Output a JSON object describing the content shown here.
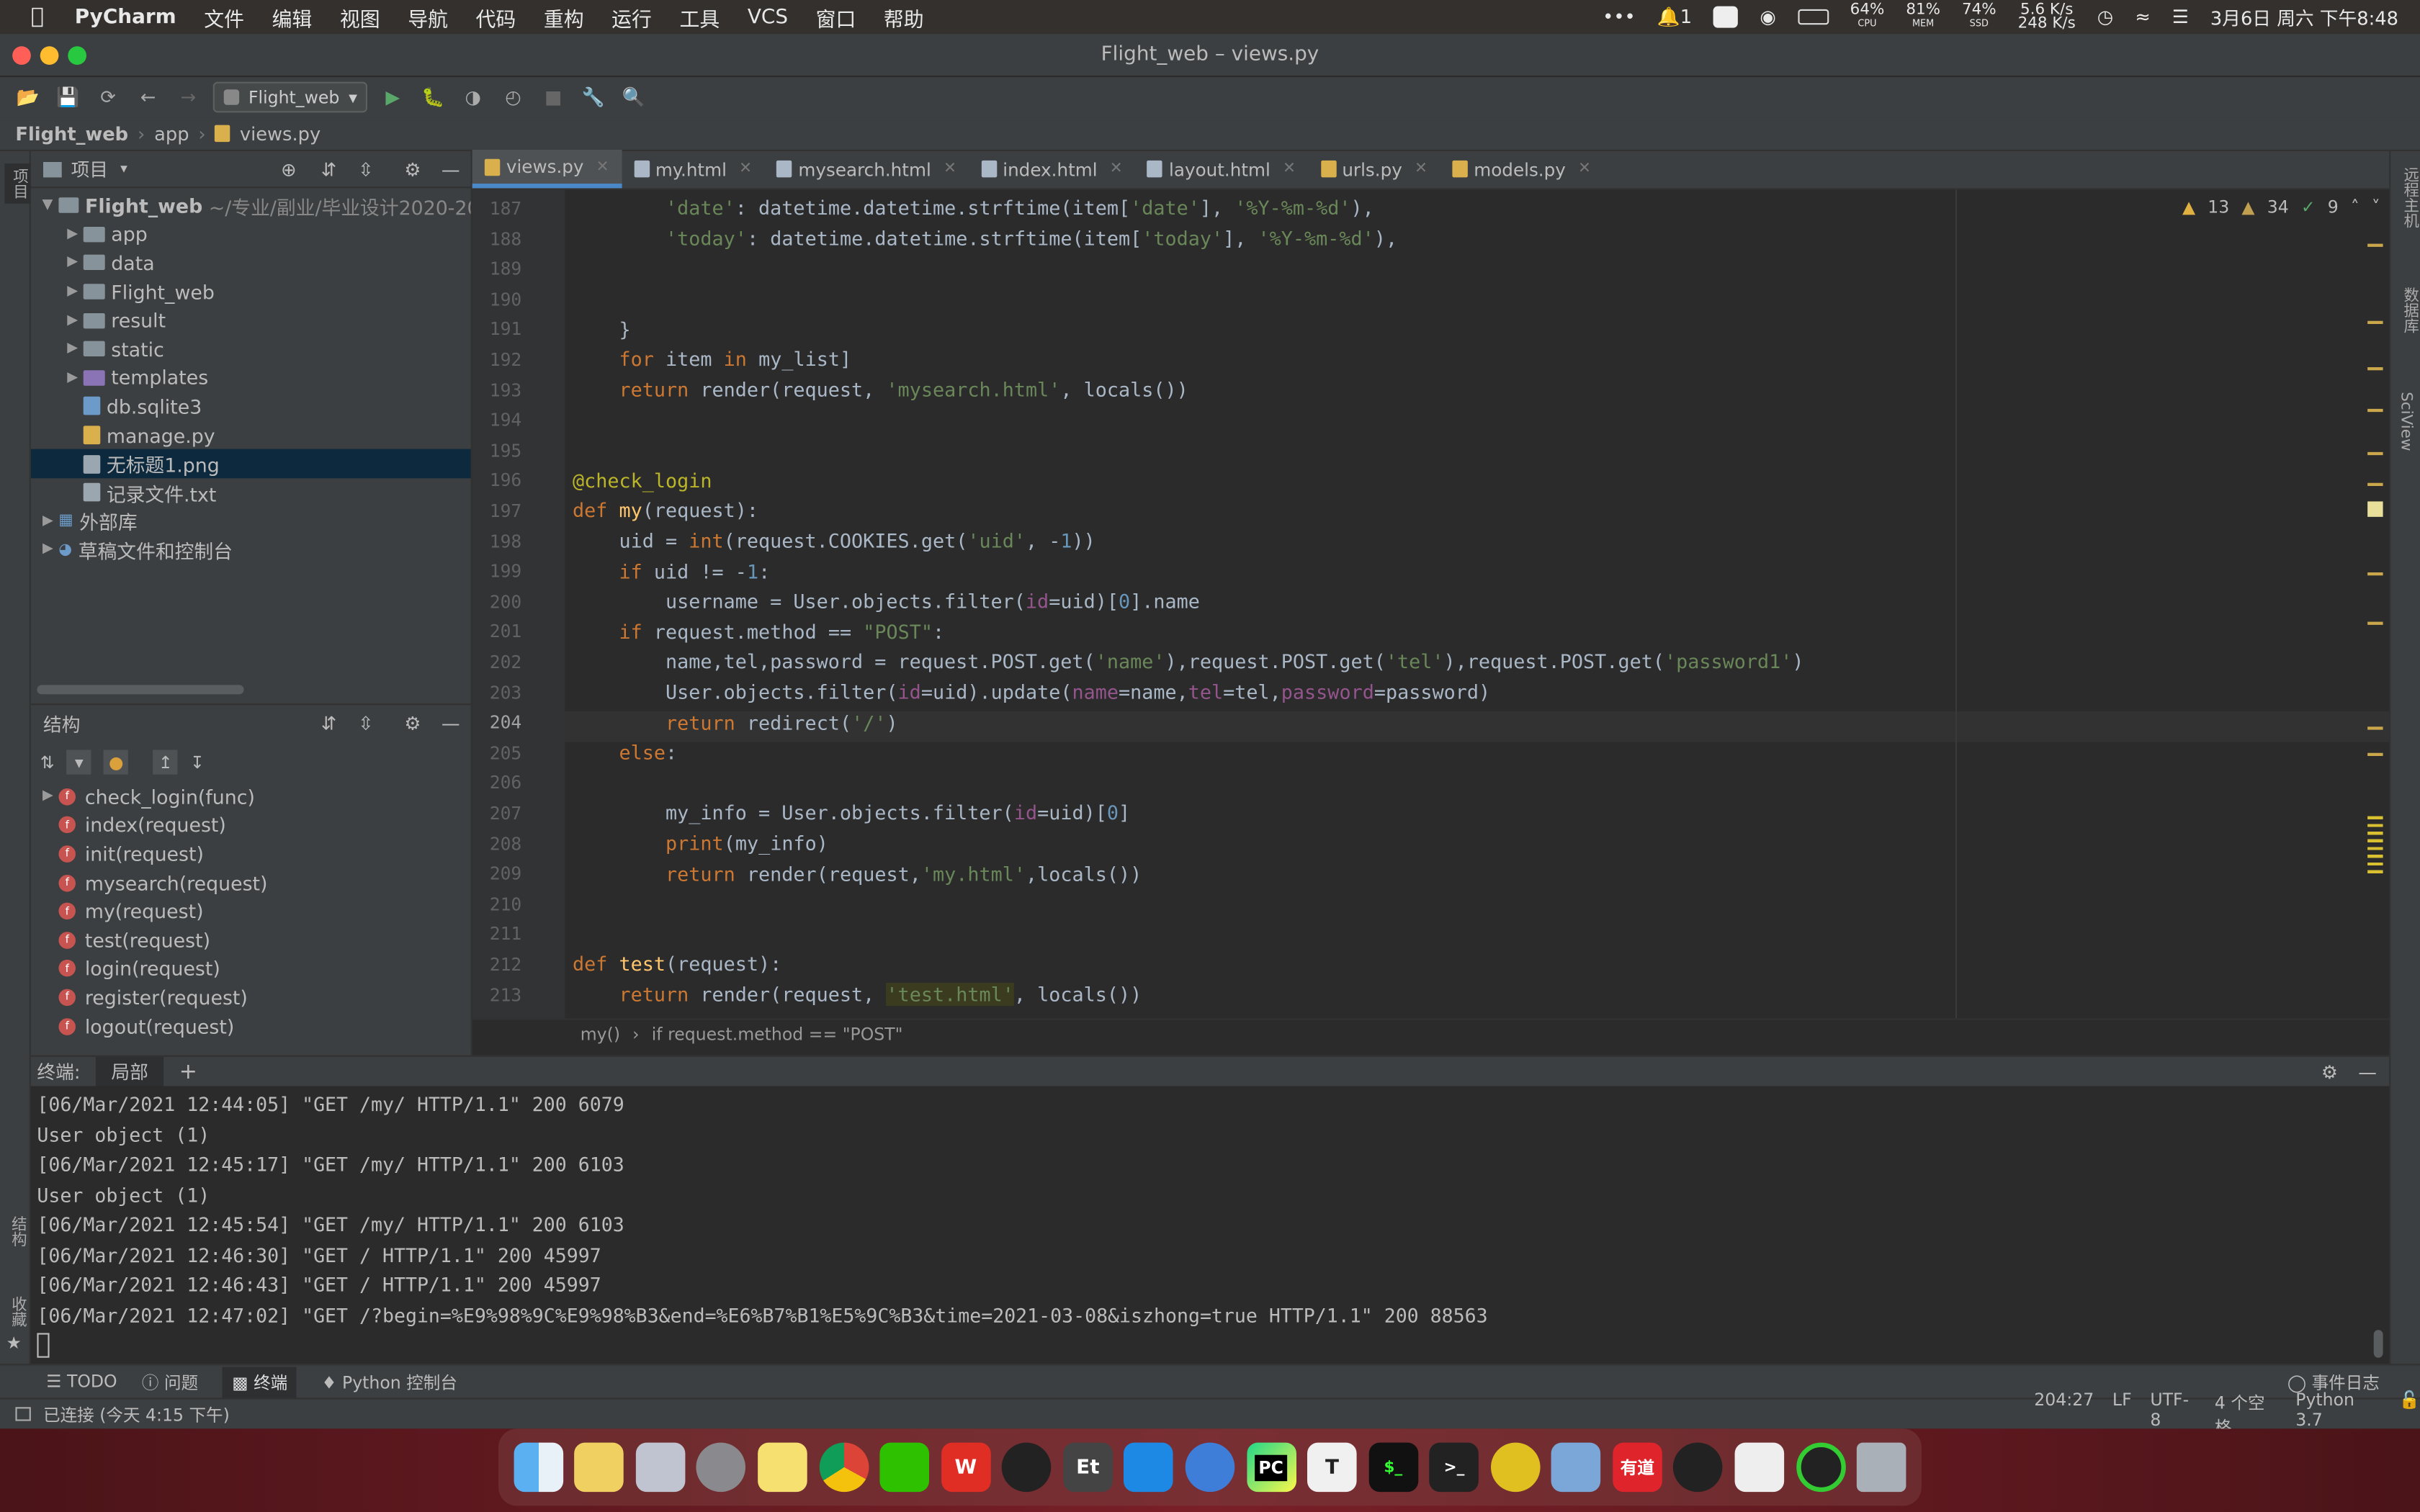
{
  "menubar": {
    "app_name": "PyCharm",
    "items": [
      "文件",
      "编辑",
      "视图",
      "导航",
      "代码",
      "重构",
      "运行",
      "工具",
      "VCS",
      "窗口",
      "帮助"
    ],
    "notification_count": "1",
    "cpu": "64%",
    "cpu_label": "CPU",
    "mem": "81%",
    "mem_label": "MEM",
    "ssd": "74%",
    "ssd_label": "SSD",
    "net_up": "5.6 K/s",
    "net_down": "248 K/s",
    "datetime": "3月6日 周六 下午8:48"
  },
  "window": {
    "title": "Flight_web – views.py"
  },
  "toolbar": {
    "run_config": "Flight_web"
  },
  "navbar": {
    "crumbs": [
      "Flight_web",
      "app",
      "views.py"
    ]
  },
  "left_strip": {
    "project": "项目",
    "structure": "结构",
    "favorites": "收藏"
  },
  "right_strip": {
    "remote": "远程主机",
    "database": "数据库",
    "sciview": "SciView"
  },
  "project": {
    "header": "项目",
    "root": "Flight_web",
    "root_path": "~/专业/副业/毕业设计2020-20",
    "items": [
      "app",
      "data",
      "Flight_web",
      "result",
      "static",
      "templates",
      "db.sqlite3",
      "manage.py",
      "无标题1.png",
      "记录文件.txt"
    ],
    "external": "外部库",
    "scratches": "草稿文件和控制台"
  },
  "structure": {
    "header": "结构",
    "items": [
      "check_login(func)",
      "index(request)",
      "init(request)",
      "mysearch(request)",
      "my(request)",
      "test(request)",
      "login(request)",
      "register(request)",
      "logout(request)"
    ],
    "badge": "f"
  },
  "tabs": [
    "views.py",
    "my.html",
    "mysearch.html",
    "index.html",
    "layout.html",
    "urls.py",
    "models.py"
  ],
  "inspection": {
    "warnings": "13",
    "weak": "34",
    "ok": "9"
  },
  "lines": [
    "187",
    "188",
    "189",
    "190",
    "191",
    "192",
    "193",
    "194",
    "195",
    "196",
    "197",
    "198",
    "199",
    "200",
    "201",
    "202",
    "203",
    "204",
    "205",
    "206",
    "207",
    "208",
    "209",
    "210",
    "211",
    "212",
    "213"
  ],
  "breadcrumb": {
    "fn": "my()",
    "cond": "if request.method == \"POST\""
  },
  "terminal": {
    "label": "终端:",
    "tab": "局部",
    "lines": [
      "[06/Mar/2021 12:44:05] \"GET /my/ HTTP/1.1\" 200 6079",
      "User object (1)",
      "[06/Mar/2021 12:45:17] \"GET /my/ HTTP/1.1\" 200 6103",
      "User object (1)",
      "[06/Mar/2021 12:45:54] \"GET /my/ HTTP/1.1\" 200 6103",
      "[06/Mar/2021 12:46:30] \"GET / HTTP/1.1\" 200 45997",
      "[06/Mar/2021 12:46:43] \"GET / HTTP/1.1\" 200 45997",
      "[06/Mar/2021 12:47:02] \"GET /?begin=%E9%98%9C%E9%98%B3&end=%E6%B7%B1%E5%9C%B3&time=2021-03-08&iszhong=true HTTP/1.1\" 200 88563"
    ]
  },
  "toolwindows": {
    "todo": "TODO",
    "problems": "问题",
    "terminal": "终端",
    "console": "Python 控制台",
    "eventlog": "事件日志"
  },
  "status": {
    "connected": "已连接 (今天 4:15 下午)",
    "pos": "204:27",
    "le": "LF",
    "enc": "UTF-8",
    "indent": "4 个空格",
    "interp": "Python 3.7"
  },
  "dock": [
    "finder",
    "notes",
    "launchpad",
    "settings",
    "stickies",
    "chrome",
    "wechat",
    "wps",
    "qq",
    "tex",
    "vscode",
    "maps",
    "pycharm",
    "typora",
    "terminal-beta",
    "terminal",
    "music",
    "preview",
    "youdao",
    "qq2",
    "textedit",
    "activity",
    "trash"
  ],
  "colors": {
    "accent": "#4a88c7",
    "keyword": "#cc7832",
    "string": "#6a8759",
    "number": "#6897bb",
    "decorator": "#bbb529",
    "function": "#ffc66d"
  }
}
